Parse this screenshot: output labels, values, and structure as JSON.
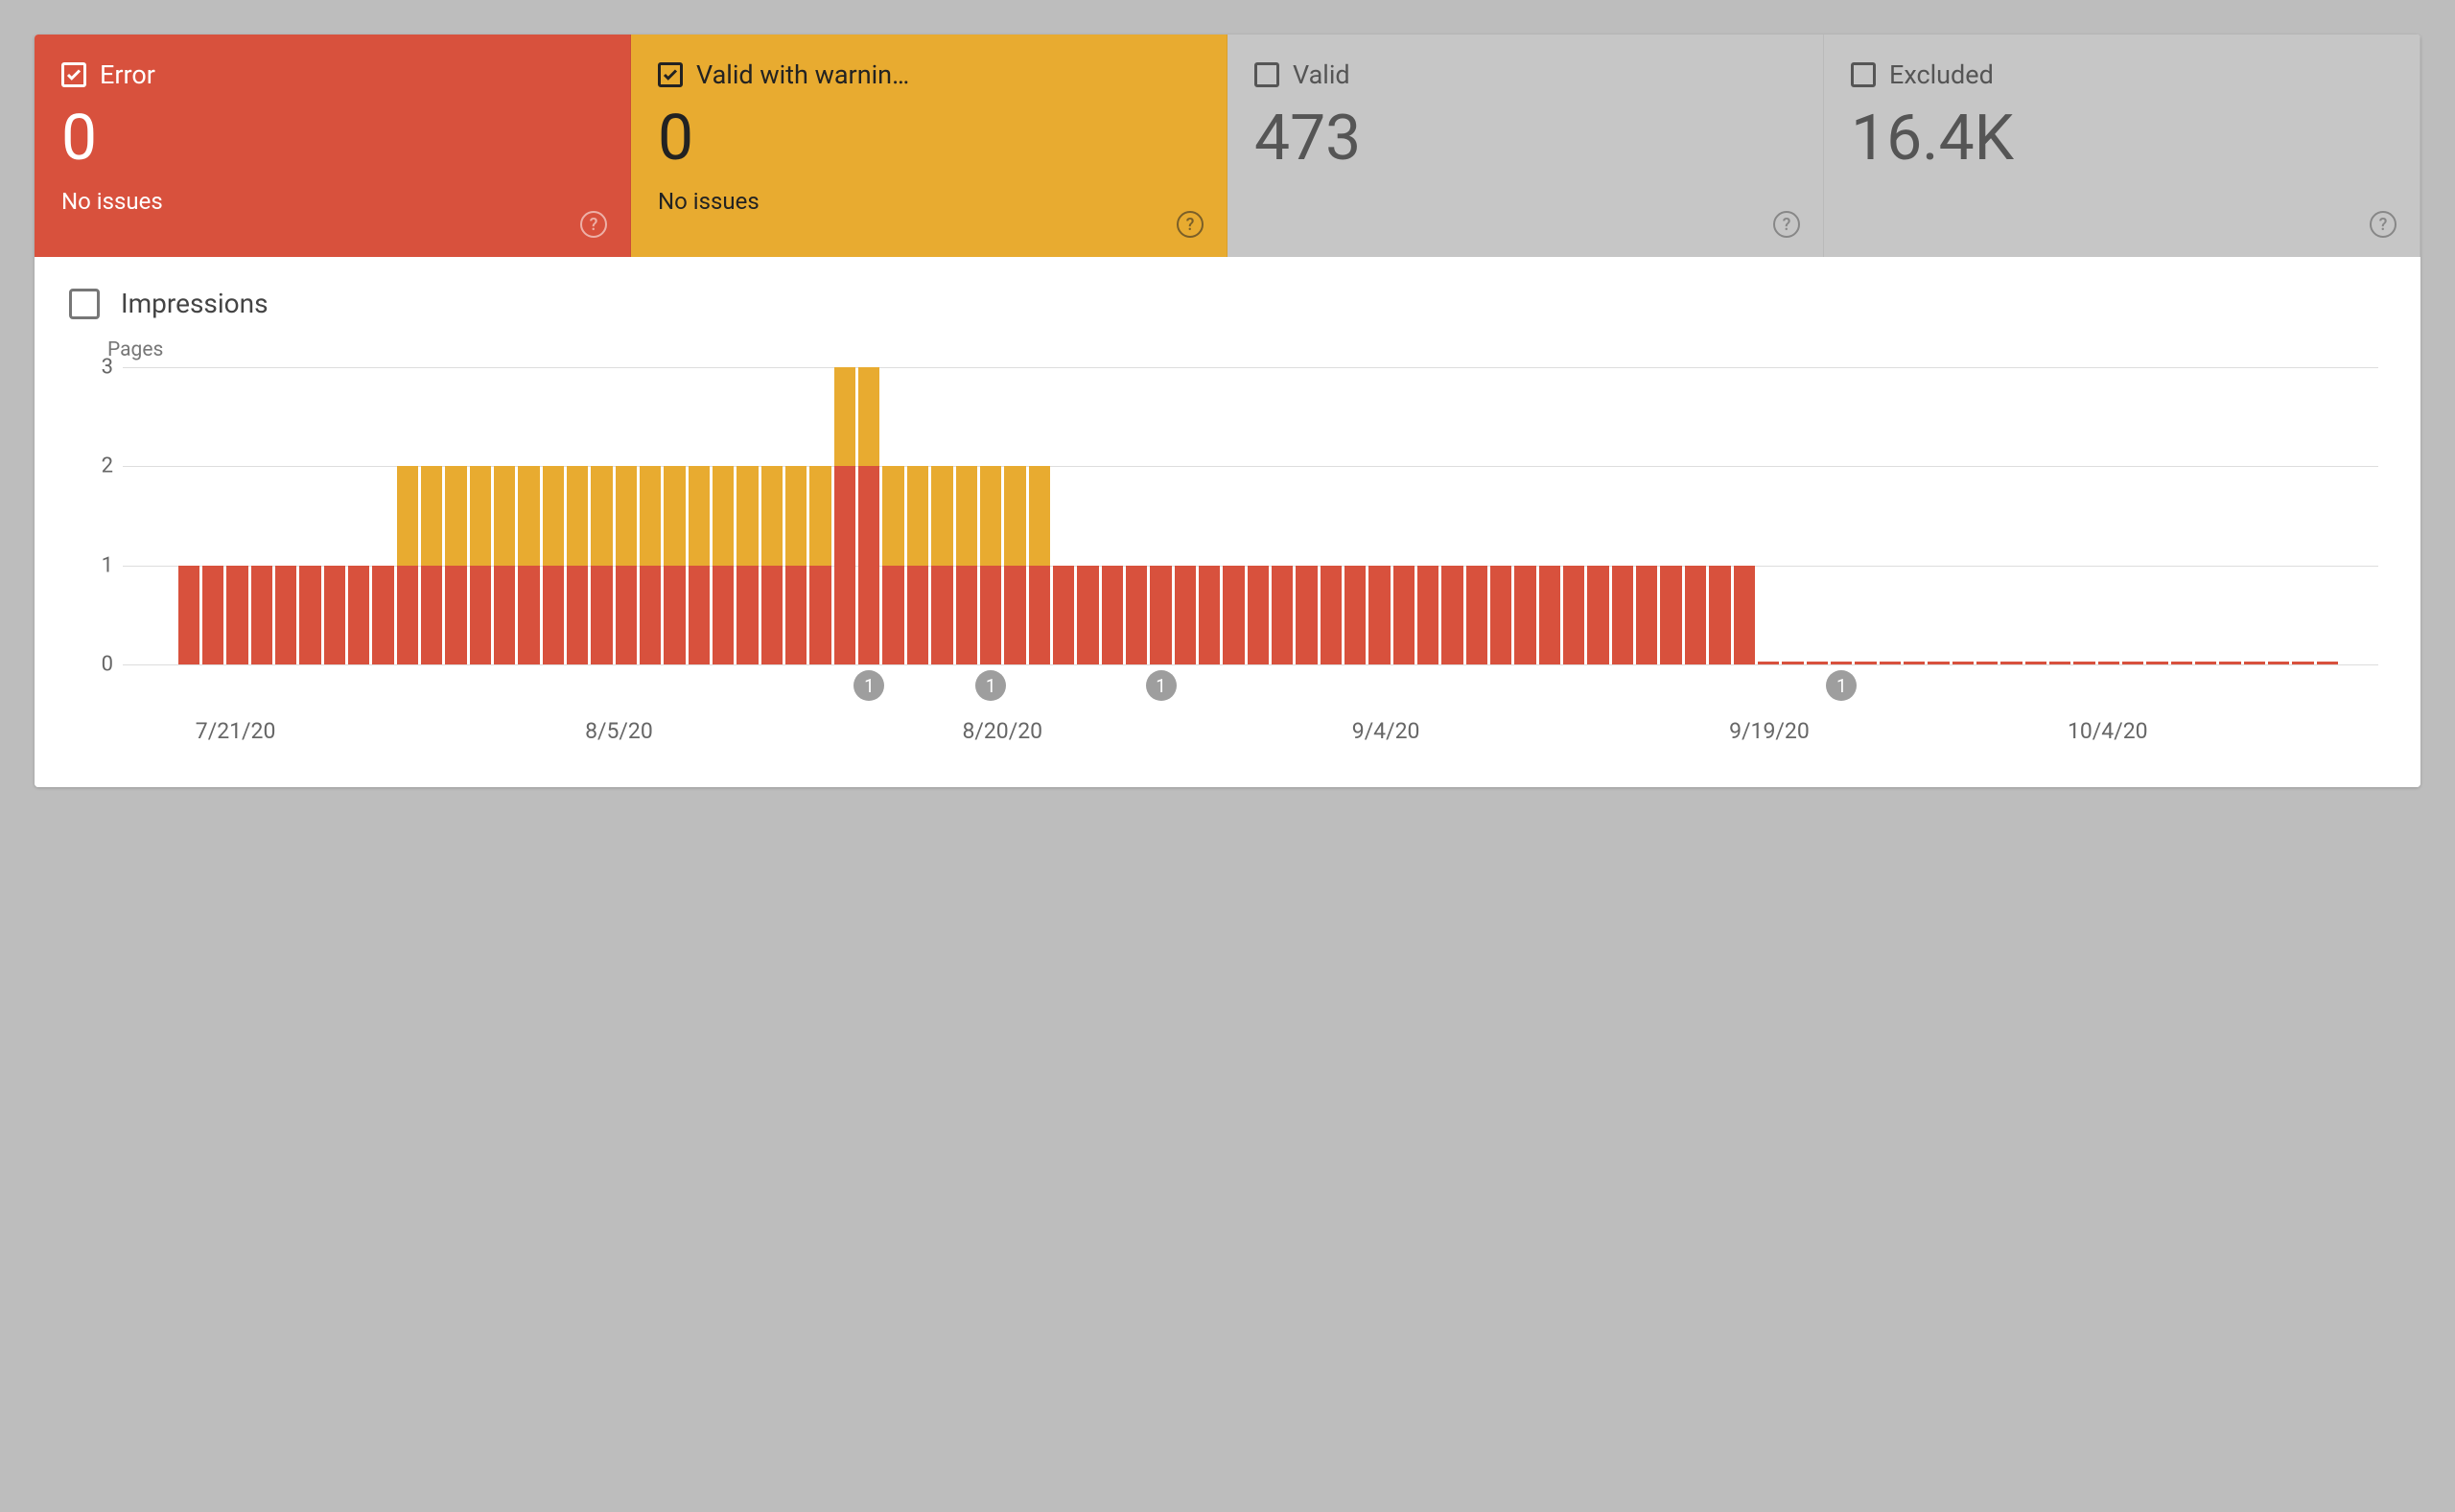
{
  "cards": [
    {
      "label": "Error",
      "value": "0",
      "sub": "No issues",
      "checked": true,
      "color": "error"
    },
    {
      "label": "Valid with warnin…",
      "value": "0",
      "sub": "No issues",
      "checked": true,
      "color": "warning"
    },
    {
      "label": "Valid",
      "value": "473",
      "sub": "",
      "checked": false,
      "color": "grey"
    },
    {
      "label": "Excluded",
      "value": "16.4K",
      "sub": "",
      "checked": false,
      "color": "grey"
    }
  ],
  "impressions_label": "Impressions",
  "chart_data": {
    "type": "bar",
    "title": "",
    "ylabel": "Pages",
    "ylim": [
      0,
      3
    ],
    "yticks": [
      0,
      1,
      2,
      3
    ],
    "x_ticks": [
      "7/21/20",
      "8/5/20",
      "8/20/20",
      "9/4/20",
      "9/19/20",
      "10/4/20"
    ],
    "markers": [
      {
        "index": 28,
        "label": "1"
      },
      {
        "index": 33,
        "label": "1"
      },
      {
        "index": 40,
        "label": "1"
      },
      {
        "index": 68,
        "label": "1"
      }
    ],
    "series": [
      {
        "name": "Error",
        "color": "red"
      },
      {
        "name": "Valid with warnings",
        "color": "yellow"
      }
    ],
    "bars": [
      {
        "r": 1,
        "y": 0
      },
      {
        "r": 1,
        "y": 0
      },
      {
        "r": 1,
        "y": 0
      },
      {
        "r": 1,
        "y": 0
      },
      {
        "r": 1,
        "y": 0
      },
      {
        "r": 1,
        "y": 0
      },
      {
        "r": 1,
        "y": 0
      },
      {
        "r": 1,
        "y": 0
      },
      {
        "r": 1,
        "y": 0
      },
      {
        "r": 1,
        "y": 1
      },
      {
        "r": 1,
        "y": 1
      },
      {
        "r": 1,
        "y": 1
      },
      {
        "r": 1,
        "y": 1
      },
      {
        "r": 1,
        "y": 1
      },
      {
        "r": 1,
        "y": 1
      },
      {
        "r": 1,
        "y": 1
      },
      {
        "r": 1,
        "y": 1
      },
      {
        "r": 1,
        "y": 1
      },
      {
        "r": 1,
        "y": 1
      },
      {
        "r": 1,
        "y": 1
      },
      {
        "r": 1,
        "y": 1
      },
      {
        "r": 1,
        "y": 1
      },
      {
        "r": 1,
        "y": 1
      },
      {
        "r": 1,
        "y": 1
      },
      {
        "r": 1,
        "y": 1
      },
      {
        "r": 1,
        "y": 1
      },
      {
        "r": 1,
        "y": 1
      },
      {
        "r": 2,
        "y": 1
      },
      {
        "r": 2,
        "y": 1
      },
      {
        "r": 1,
        "y": 1
      },
      {
        "r": 1,
        "y": 1
      },
      {
        "r": 1,
        "y": 1
      },
      {
        "r": 1,
        "y": 1
      },
      {
        "r": 1,
        "y": 1
      },
      {
        "r": 1,
        "y": 1
      },
      {
        "r": 1,
        "y": 1
      },
      {
        "r": 1,
        "y": 0
      },
      {
        "r": 1,
        "y": 0
      },
      {
        "r": 1,
        "y": 0
      },
      {
        "r": 1,
        "y": 0
      },
      {
        "r": 1,
        "y": 0
      },
      {
        "r": 1,
        "y": 0
      },
      {
        "r": 1,
        "y": 0
      },
      {
        "r": 1,
        "y": 0
      },
      {
        "r": 1,
        "y": 0
      },
      {
        "r": 1,
        "y": 0
      },
      {
        "r": 1,
        "y": 0
      },
      {
        "r": 1,
        "y": 0
      },
      {
        "r": 1,
        "y": 0
      },
      {
        "r": 1,
        "y": 0
      },
      {
        "r": 1,
        "y": 0
      },
      {
        "r": 1,
        "y": 0
      },
      {
        "r": 1,
        "y": 0
      },
      {
        "r": 1,
        "y": 0
      },
      {
        "r": 1,
        "y": 0
      },
      {
        "r": 1,
        "y": 0
      },
      {
        "r": 1,
        "y": 0
      },
      {
        "r": 1,
        "y": 0
      },
      {
        "r": 1,
        "y": 0
      },
      {
        "r": 1,
        "y": 0
      },
      {
        "r": 1,
        "y": 0
      },
      {
        "r": 1,
        "y": 0
      },
      {
        "r": 1,
        "y": 0
      },
      {
        "r": 1,
        "y": 0
      },
      {
        "r": 1,
        "y": 0
      },
      {
        "r": 0,
        "y": 0
      },
      {
        "r": 0,
        "y": 0
      },
      {
        "r": 0,
        "y": 0
      },
      {
        "r": 0,
        "y": 0
      },
      {
        "r": 0,
        "y": 0
      },
      {
        "r": 0,
        "y": 0
      },
      {
        "r": 0,
        "y": 0
      },
      {
        "r": 0,
        "y": 0
      },
      {
        "r": 0,
        "y": 0
      },
      {
        "r": 0,
        "y": 0
      },
      {
        "r": 0,
        "y": 0
      },
      {
        "r": 0,
        "y": 0
      },
      {
        "r": 0,
        "y": 0
      },
      {
        "r": 0,
        "y": 0
      },
      {
        "r": 0,
        "y": 0
      },
      {
        "r": 0,
        "y": 0
      },
      {
        "r": 0,
        "y": 0
      },
      {
        "r": 0,
        "y": 0
      },
      {
        "r": 0,
        "y": 0
      },
      {
        "r": 0,
        "y": 0
      },
      {
        "r": 0,
        "y": 0
      },
      {
        "r": 0,
        "y": 0
      },
      {
        "r": 0,
        "y": 0
      },
      {
        "r": 0,
        "y": 0
      }
    ]
  }
}
